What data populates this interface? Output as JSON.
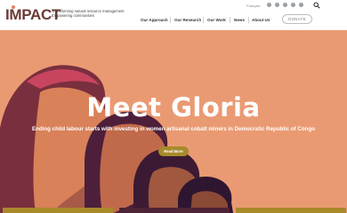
{
  "logo": {
    "wordmark": "IMPACT",
    "tagline_line1": "Transforming natural resource management",
    "tagline_line2": "Empowering communities"
  },
  "language": "Français",
  "social_icons": [
    "facebook-icon",
    "twitter-icon",
    "instagram-icon",
    "linkedin-icon",
    "youtube-icon"
  ],
  "nav": {
    "items": [
      {
        "label": "Our Approach"
      },
      {
        "label": "Our Research"
      },
      {
        "label": "Our Work"
      },
      {
        "label": "News"
      },
      {
        "label": "About Us"
      }
    ],
    "donate_label": "DONATE"
  },
  "hero": {
    "title": "Meet Gloria",
    "subtitle": "Ending child labour starts with investing in women artisanal cobalt miners in Democratic Republic of Congo",
    "button_label": "Read More"
  },
  "colors": {
    "hero_background": "#ea9a72",
    "brand_brown": "#6b3a35",
    "button_olive": "#a88a2b"
  }
}
